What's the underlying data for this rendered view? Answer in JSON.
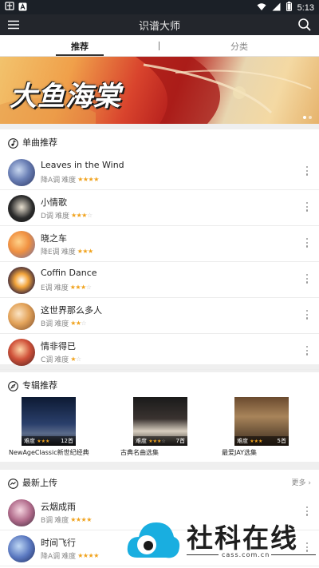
{
  "status_bar": {
    "time": "5:13",
    "left_icons": [
      "notification-icon",
      "app-icon"
    ],
    "right_icons": [
      "wifi-icon",
      "signal-icon",
      "battery-icon"
    ]
  },
  "app_bar": {
    "title": "识谱大师",
    "menu_icon": "menu-icon",
    "search_icon": "search-icon"
  },
  "tabs": [
    {
      "label": "推荐",
      "active": true
    },
    {
      "label": "分类",
      "active": false
    }
  ],
  "banner": {
    "title": "大鱼海棠",
    "page_count": 2,
    "active_index": 0
  },
  "singles": {
    "title": "单曲推荐",
    "icon": "music-note-icon",
    "difficulty_label": "难度",
    "items": [
      {
        "name": "Leaves in the Wind",
        "key": "降A调",
        "stars": 4,
        "max": 4
      },
      {
        "name": " 小情歌",
        "key": "D调",
        "stars": 3,
        "max": 4
      },
      {
        "name": "晓之车",
        "key": "降E调",
        "stars": 3,
        "max": 3
      },
      {
        "name": "Coffin Dance",
        "key": "E调",
        "stars": 3,
        "max": 4
      },
      {
        "name": "这世界那么多人",
        "key": "B调",
        "stars": 2,
        "max": 3
      },
      {
        "name": "情非得已",
        "key": "C调",
        "stars": 1,
        "max": 2
      }
    ]
  },
  "albums": {
    "title": "专辑推荐",
    "icon": "compass-icon",
    "difficulty_label": "难度",
    "items": [
      {
        "name": "NewAgeClassic新世纪经典",
        "count": "12首",
        "stars": 3,
        "max": 3
      },
      {
        "name": "古典名曲选集",
        "count": "7首",
        "stars": 3,
        "max": 4
      },
      {
        "name": "最爱JAY选集",
        "count": "5首",
        "stars": 3,
        "max": 3
      }
    ]
  },
  "latest": {
    "title": "最新上传",
    "icon": "messenger-icon",
    "more": "更多",
    "difficulty_label": "难度",
    "items": [
      {
        "name": "云烟成雨",
        "key": "B调",
        "stars": 4,
        "max": 4
      },
      {
        "name": "时间飞行",
        "key": "降A调",
        "stars": 4,
        "max": 4
      }
    ]
  },
  "watermark": {
    "text": "社科在线",
    "url": "cass.com.cn"
  },
  "colors": {
    "star": "#f0a21c",
    "appbar": "#23262c",
    "statusbar": "#1b2027"
  }
}
